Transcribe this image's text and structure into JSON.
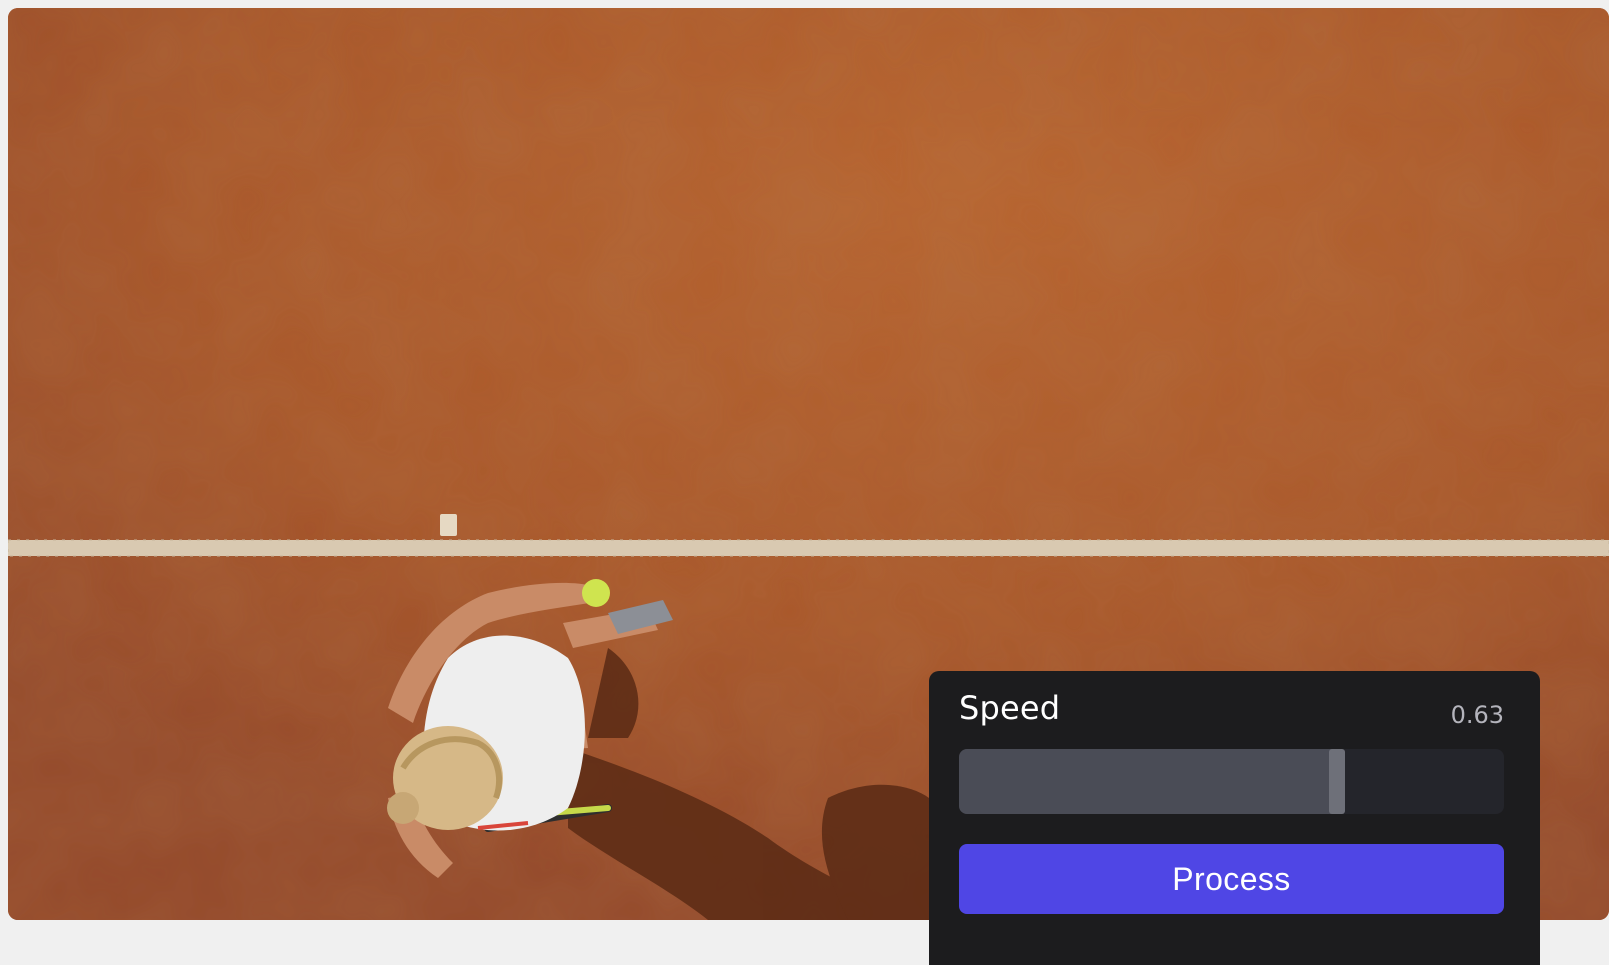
{
  "video": {
    "scene": "tennis-player-serving-on-clay-court"
  },
  "controls": {
    "speed_label": "Speed",
    "speed_value": "0.63",
    "speed_fraction": 0.7,
    "process_label": "Process"
  },
  "colors": {
    "clay": "#a9572a",
    "panel_bg": "#1c1c1e",
    "slider_track": "#24252b",
    "slider_fill": "#4a4c56",
    "accent": "#4f46e5"
  }
}
